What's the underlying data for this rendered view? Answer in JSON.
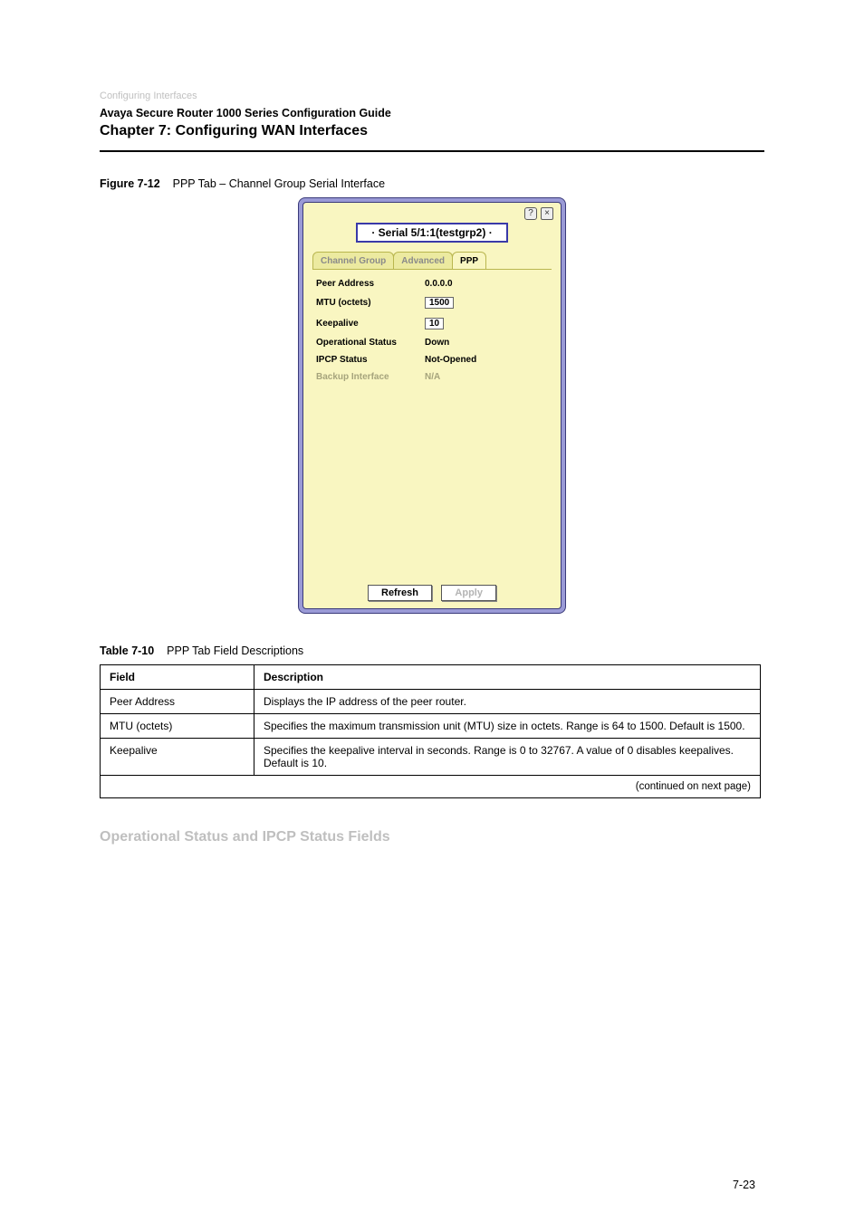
{
  "header": {
    "upper": "Configuring Interfaces",
    "pub": "Avaya Secure Router 1000 Series Configuration Guide",
    "chapter": "Chapter 7: Configuring WAN Interfaces"
  },
  "figure_label_prefix": "Figure 7-12",
  "figure_label_text": "PPP Tab – Channel Group Serial Interface",
  "screenshot": {
    "breadcrumb": "· Serial 5/1:1(testgrp2) ·",
    "tabs": [
      "Channel Group",
      "Advanced",
      "PPP"
    ],
    "rows": {
      "peer_address_label": "Peer Address",
      "peer_address_value": "0.0.0.0",
      "mtu_label": "MTU (octets)",
      "mtu_value": "1500",
      "keepalive_label": "Keepalive",
      "keepalive_value": "10",
      "op_status_label": "Operational Status",
      "op_status_value": "Down",
      "ipcp_label": "IPCP Status",
      "ipcp_value": "Not-Opened",
      "backup_label": "Backup Interface",
      "backup_value": "N/A"
    },
    "buttons": {
      "refresh": "Refresh",
      "apply": "Apply"
    }
  },
  "table_label_prefix": "Table 7-10",
  "table_label_text": "PPP Tab Field Descriptions",
  "table": {
    "head_field": "Field",
    "head_desc": "Description",
    "rows": [
      {
        "f": "Peer Address",
        "d": "Displays the IP address of the peer router."
      },
      {
        "f": "MTU (octets)",
        "d": "Specifies the maximum transmission unit (MTU) size in octets. Range is 64 to 1500. Default is 1500."
      },
      {
        "f": "Keepalive",
        "d": "Specifies the keepalive interval in seconds. Range is 0 to 32767. A value of 0 disables keepalives. Default is 10."
      }
    ],
    "note": "(continued on next page)"
  },
  "section_head": "Operational Status and IPCP Status Fields",
  "page_number": "7-23"
}
